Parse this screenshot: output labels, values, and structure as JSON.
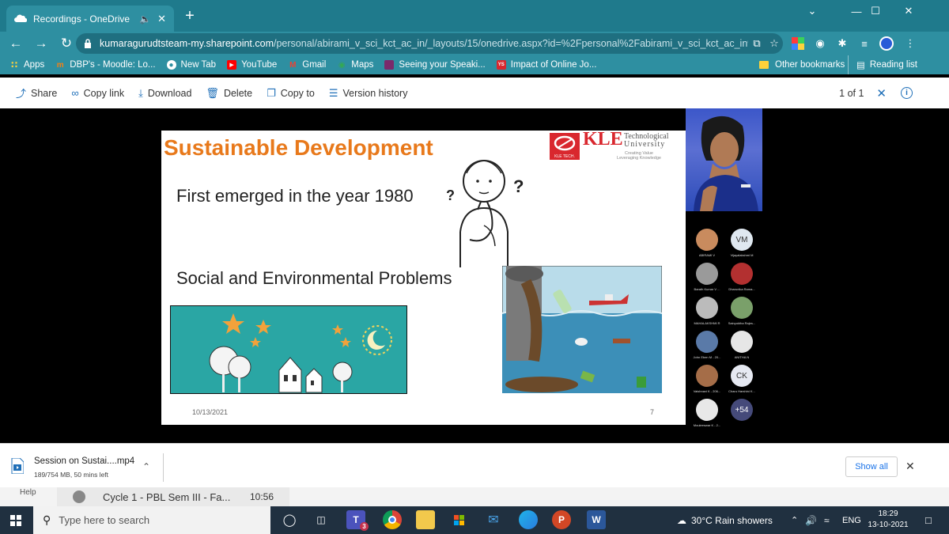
{
  "browser": {
    "tab_title": "Recordings - OneDrive",
    "url_host": "kumaragurudtsteam-my.sharepoint.com",
    "url_path": "/personal/abirami_v_sci_kct_ac_in/_layouts/15/onedrive.aspx?id=%2Fpersonal%2Fabirami_v_sci_kct_ac_in%...",
    "bookmarks": [
      "Apps",
      "DBP's - Moodle: Lo...",
      "New Tab",
      "YouTube",
      "Gmail",
      "Maps",
      "Seeing your Speaki...",
      "Impact of Online Jo..."
    ],
    "other_bookmarks": "Other bookmarks",
    "reading_list": "Reading list"
  },
  "toolbar": {
    "share": "Share",
    "copy_link": "Copy link",
    "download": "Download",
    "delete": "Delete",
    "copy_to": "Copy to",
    "version_history": "Version history",
    "page_counter": "1 of 1"
  },
  "slide": {
    "title": "Sustainable Development",
    "logo_brand": "KLE",
    "logo_line1": "Technological",
    "logo_line2": "University",
    "logo_tag1": "Creating Value",
    "logo_tag2": "Leveraging Knowledge",
    "logo_badge": "KLE TECH.",
    "line1": "First emerged in the year 1980",
    "line2": "Social  and  Environmental Problems",
    "date": "10/13/2021",
    "page": "7"
  },
  "participants": {
    "list": [
      {
        "name": "ABIRAMI V",
        "initials": "",
        "color": "#c98b5e"
      },
      {
        "name": "Vijayalakshmi M",
        "initials": "VM",
        "color": "#dfe8f0"
      },
      {
        "name": "Barath Kumar V ...",
        "initials": "",
        "color": "#9a9a9a"
      },
      {
        "name": "Dharunika Rama...",
        "initials": "",
        "color": "#b33030"
      },
      {
        "name": "MAHALAKSHMI R",
        "initials": "",
        "color": "#bbbbbb"
      },
      {
        "name": "Sainyuktha Rajes...",
        "initials": "",
        "color": "#7aa06a"
      },
      {
        "name": "John Eben M - 20...",
        "initials": "",
        "color": "#5a7aa8"
      },
      {
        "name": "ANITHA N",
        "initials": "",
        "color": "#e6e6e6"
      },
      {
        "name": "Vaishnavi K - 206...",
        "initials": "",
        "color": "#a56d48"
      },
      {
        "name": "Charu Harshini K...",
        "initials": "CK",
        "color": "#e6e9f2"
      },
      {
        "name": "Mouleeswar K - 2...",
        "initials": "",
        "color": "#e8e8e8"
      }
    ],
    "more": "+54"
  },
  "download": {
    "file_name": "Session on Sustai....mp4",
    "status": "189/754 MB, 50 mins left",
    "show_all": "Show all"
  },
  "behind": {
    "help": "Help",
    "meeting_title": "Cycle 1 - PBL Sem III - Fa...",
    "meeting_time": "10:56"
  },
  "taskbar": {
    "search_placeholder": "Type here to search",
    "teams_badge": "3",
    "weather": "30°C  Rain showers",
    "language": "ENG",
    "time": "18:29",
    "date": "13-10-2021"
  }
}
